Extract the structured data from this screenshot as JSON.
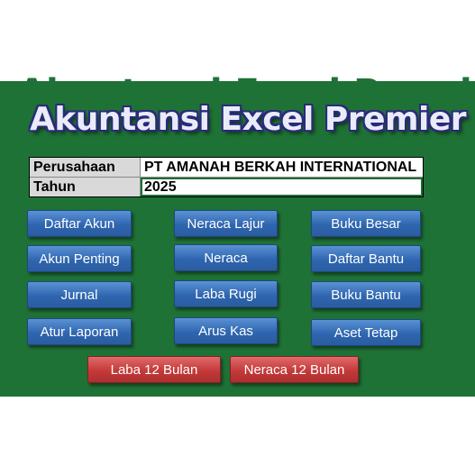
{
  "app": {
    "title": "Akuntansi Excel Premier"
  },
  "info": {
    "company_label": "Perusahaan",
    "company_value": "PT AMANAH BERKAH INTERNATIONAL",
    "year_label": "Tahun",
    "year_value": "2025"
  },
  "buttons": {
    "col1": [
      "Daftar Akun",
      "Akun Penting",
      "Jurnal",
      "Atur Laporan"
    ],
    "col2": [
      "Neraca Lajur",
      "Neraca",
      "Laba Rugi",
      "Arus Kas"
    ],
    "col3": [
      "Buku Besar",
      "Daftar Bantu",
      "Buku Bantu",
      "Aset Tetap"
    ],
    "bottom": [
      "Laba 12 Bulan",
      "Neraca 12 Bulan"
    ]
  },
  "colors": {
    "panel": "#1f7236",
    "blue_button": "#2f66b0",
    "red_button": "#c43a3a"
  }
}
